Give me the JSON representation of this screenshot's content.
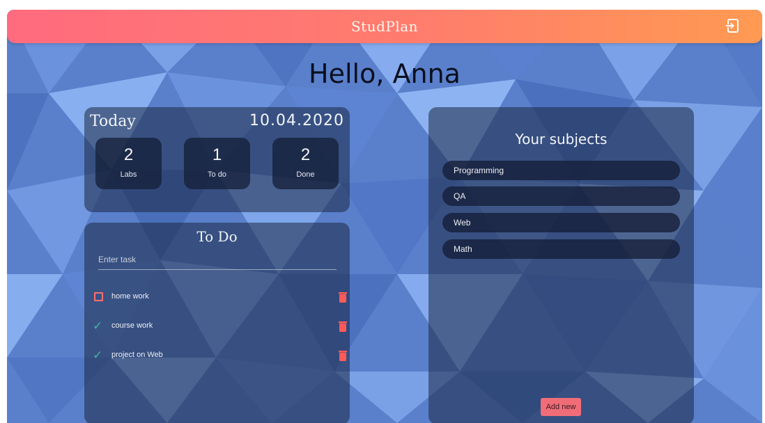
{
  "app": {
    "title": "StudPlan",
    "logout_icon": "logout-icon"
  },
  "greeting": "Hello, Anna",
  "today": {
    "title": "Today",
    "date": "10.04.2020",
    "stats": [
      {
        "value": "2",
        "label": "Labs"
      },
      {
        "value": "1",
        "label": "To do"
      },
      {
        "value": "2",
        "label": "Done"
      }
    ]
  },
  "todo": {
    "title": "To Do",
    "input_placeholder": "Enter task",
    "input_value": "",
    "tasks": [
      {
        "text": "home work",
        "done": false
      },
      {
        "text": "course work",
        "done": true
      },
      {
        "text": "project on Web",
        "done": true
      }
    ]
  },
  "subjects": {
    "title": "Your subjects",
    "items": [
      "Programming",
      "QA",
      "Web",
      "Math"
    ],
    "add_label": "Add new"
  },
  "colors": {
    "header_start": "#ff6b7e",
    "header_end": "#ff9a52",
    "background": "#5b82cf",
    "trash": "#ff5a5a",
    "check": "#3fb7a2",
    "add_button": "#f06d78"
  }
}
